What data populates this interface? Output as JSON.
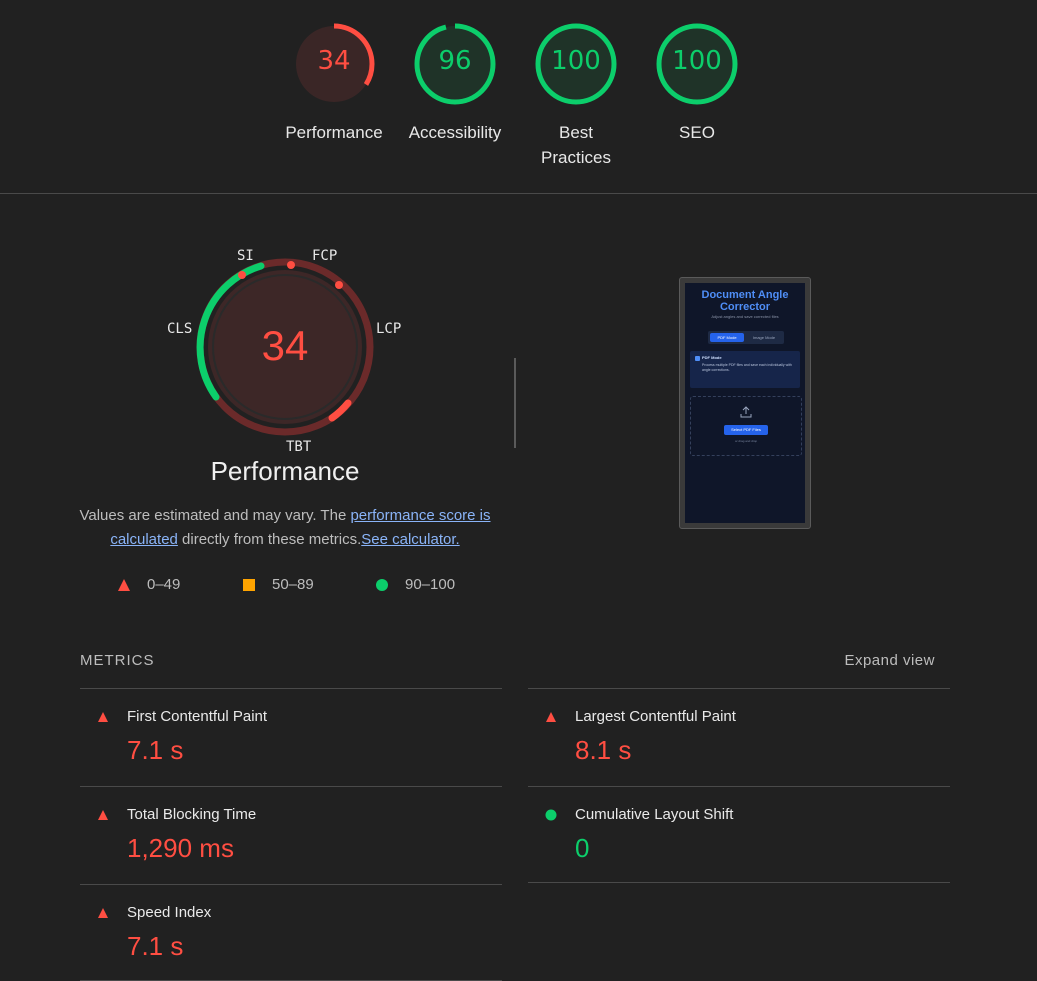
{
  "colors": {
    "fail": "#ff4e42",
    "average": "#ffa400",
    "pass": "#0cce6b"
  },
  "top_gauges": [
    {
      "score": "34",
      "label": "Performance",
      "status": "fail",
      "score_value": 34
    },
    {
      "score": "96",
      "label": "Accessibility",
      "status": "pass",
      "score_value": 96
    },
    {
      "score": "100",
      "label": "Best Practices",
      "status": "pass",
      "score_value": 100
    },
    {
      "score": "100",
      "label": "SEO",
      "status": "pass",
      "score_value": 100
    }
  ],
  "performance": {
    "score": "34",
    "title": "Performance",
    "metric_tags": {
      "si": "SI",
      "fcp": "FCP",
      "lcp": "LCP",
      "tbt": "TBT",
      "cls": "CLS"
    },
    "description_prefix": "Values are estimated and may vary. The ",
    "score_link": "performance score is calculated",
    "description_mid": " directly from these metrics.",
    "calculator_link": "See calculator."
  },
  "legend": [
    {
      "shape": "triangle",
      "range": "0–49"
    },
    {
      "shape": "square",
      "range": "50–89"
    },
    {
      "shape": "circle",
      "range": "90–100"
    }
  ],
  "screenshot": {
    "title": "Document Angle Corrector",
    "subtitle": "Adjust angles and save corrected files",
    "tab_active": "PDF Mode",
    "tab_inactive": "Image Mode",
    "card_title": "PDF Mode",
    "card_text": "Process multiple PDF files and save each individually with angle corrections.",
    "button": "Select PDF Files",
    "drop_hint": "or drag and drop"
  },
  "metrics": {
    "heading": "METRICS",
    "expand_label": "Expand view",
    "items": [
      {
        "name": "First Contentful Paint",
        "value": "7.1 s",
        "status": "fail"
      },
      {
        "name": "Largest Contentful Paint",
        "value": "8.1 s",
        "status": "fail"
      },
      {
        "name": "Total Blocking Time",
        "value": "1,290 ms",
        "status": "fail"
      },
      {
        "name": "Cumulative Layout Shift",
        "value": "0",
        "status": "pass"
      },
      {
        "name": "Speed Index",
        "value": "7.1 s",
        "status": "fail"
      }
    ]
  }
}
